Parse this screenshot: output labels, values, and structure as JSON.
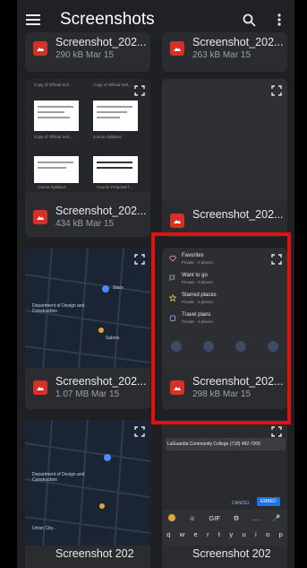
{
  "app": {
    "title": "Screenshots",
    "menu_icon": "menu-icon",
    "search_icon": "search-icon",
    "more_icon": "more-vert-icon",
    "accent": "#d93025"
  },
  "files": [
    {
      "name": "Screenshot_202...",
      "size": "290 kB",
      "date": "Mar 15"
    },
    {
      "name": "Screenshot_202...",
      "size": "263 kB",
      "date": "Mar 15"
    },
    {
      "name": "Screenshot_202...",
      "size": "434 kB",
      "date": "Mar 15"
    },
    {
      "name": "Screenshot_202...",
      "size": "",
      "date": ""
    },
    {
      "name": "Screenshot_202...",
      "size": "1.07 MB",
      "date": "Mar 15"
    },
    {
      "name": "Screenshot_202...",
      "size": "298 kB",
      "date": "Mar 15"
    },
    {
      "name": "Screenshot 202",
      "size": "",
      "date": ""
    },
    {
      "name": "Screenshot 202",
      "size": "",
      "date": ""
    }
  ],
  "drive_thumb": {
    "docs": [
      "Copy of Official Sch...",
      "Copy of Official Sch...",
      "Copy of Official Sch...",
      "course Syllabus",
      "course Syllabus",
      "Course Proposal f..."
    ]
  },
  "map_thumb": {
    "labels": [
      "Stars",
      "Department of Design and Construction",
      "Salons",
      "Union City..."
    ]
  },
  "saved_list": {
    "items": [
      {
        "name": "Favorites",
        "sub": "Private · 0 places"
      },
      {
        "name": "Want to go",
        "sub": "Private · 0 places"
      },
      {
        "name": "Starred places",
        "sub": "Private · 0 places"
      },
      {
        "name": "Travel plans",
        "sub": "Private · 0 places"
      }
    ]
  },
  "note_thumb": {
    "text": "LaGuardia Community College (718) 482-7200",
    "cancel": "CANCEL",
    "send": "EMBED",
    "keys": [
      "q",
      "w",
      "e",
      "r",
      "t",
      "y",
      "u",
      "i",
      "o",
      "p"
    ]
  }
}
